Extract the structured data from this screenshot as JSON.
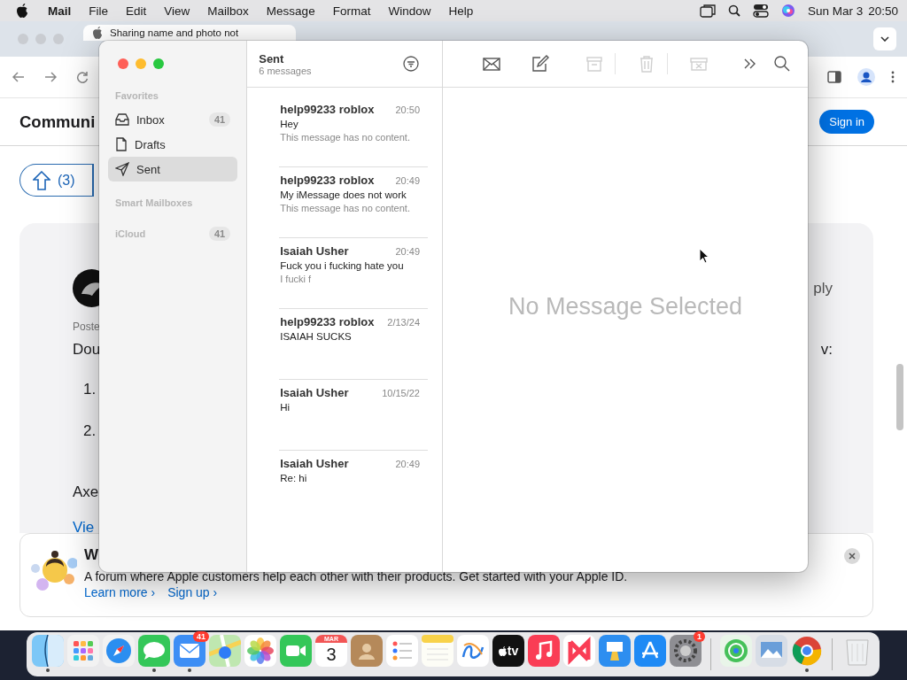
{
  "menu_bar": {
    "app": "Mail",
    "menus": [
      "File",
      "Edit",
      "View",
      "Mailbox",
      "Message",
      "Format",
      "Window",
      "Help"
    ],
    "date": "Sun Mar 3",
    "time": "20:50"
  },
  "browser": {
    "tab": {
      "title": "Sharing name and photo not"
    },
    "page": {
      "heading": "Communi",
      "sign_in": "Sign in",
      "vote_count": "(3)",
      "post": {
        "right_top": "ply",
        "posted": "Poste",
        "line": "Dou",
        "right_line": "v:",
        "list": [
          "1.",
          "2."
        ],
        "author": "Axe",
        "link": "Vie"
      },
      "banner": {
        "title": "W",
        "text": "A forum where Apple customers help each other with their products. Get started with your Apple ID.",
        "links": [
          "Learn more ›",
          "Sign up ›"
        ]
      }
    }
  },
  "mail": {
    "sidebar": [
      {
        "kind": "header",
        "label": "Favorites"
      },
      {
        "kind": "inbox",
        "label": "Inbox",
        "count": "41",
        "selected": false
      },
      {
        "kind": "drafts",
        "label": "Drafts",
        "selected": false
      },
      {
        "kind": "sent",
        "label": "Sent",
        "selected": true
      },
      {
        "kind": "header",
        "label": "Smart Mailboxes"
      },
      {
        "kind": "header",
        "label": "iCloud",
        "count": "41"
      }
    ],
    "list": {
      "title": "Sent",
      "subtitle": "6 messages"
    },
    "messages": [
      {
        "sender": "help99233 roblox",
        "time": "20:50",
        "subject": "Hey",
        "preview": "This message has no content."
      },
      {
        "sender": "help99233 roblox",
        "time": "20:49",
        "subject": "My iMessage does not work",
        "preview": "This message has no content."
      },
      {
        "sender": "Isaiah Usher",
        "time": "20:49",
        "subject": "Fuck you i fucking hate you",
        "preview": "I fucki f"
      },
      {
        "sender": "help99233 roblox",
        "time": "2/13/24",
        "subject": "ISAIAH SUCKS"
      },
      {
        "sender": "Isaiah Usher",
        "time": "10/15/22",
        "subject": "Hi"
      },
      {
        "sender": "Isaiah Usher",
        "time": "20:49",
        "subject": "Re: hi"
      }
    ],
    "toolbar": [
      {
        "kind": "get_mail",
        "disabled": false
      },
      {
        "kind": "compose",
        "disabled": false
      },
      {
        "kind": "archive",
        "disabled": true
      },
      {
        "kind": "trash",
        "disabled": true
      },
      {
        "kind": "junk",
        "disabled": true
      },
      {
        "kind": "more",
        "disabled": false
      },
      {
        "kind": "search",
        "disabled": false
      }
    ],
    "empty_text": "No Message Selected"
  },
  "dock": [
    {
      "kind": "finder",
      "running": true
    },
    {
      "kind": "launchpad",
      "running": false
    },
    {
      "kind": "safari",
      "running": false
    },
    {
      "kind": "messages",
      "running": true
    },
    {
      "kind": "mail",
      "running": true,
      "badge": "41"
    },
    {
      "kind": "maps",
      "running": false
    },
    {
      "kind": "photos",
      "running": false
    },
    {
      "kind": "facetime",
      "running": false
    },
    {
      "kind": "calendar",
      "running": false,
      "month": "MAR",
      "day": "3"
    },
    {
      "kind": "contacts",
      "running": false
    },
    {
      "kind": "reminders",
      "running": false
    },
    {
      "kind": "notes",
      "running": false
    },
    {
      "kind": "freeform",
      "running": false
    },
    {
      "kind": "tv",
      "running": false,
      "label": "tv"
    },
    {
      "kind": "music",
      "running": false
    },
    {
      "kind": "news",
      "running": false
    },
    {
      "kind": "keynote",
      "running": false
    },
    {
      "kind": "appstore",
      "running": false
    },
    {
      "kind": "settings",
      "running": false,
      "badge": "1"
    },
    {
      "kind": "separator"
    },
    {
      "kind": "findmy",
      "running": false
    },
    {
      "kind": "preview",
      "running": false
    },
    {
      "kind": "chrome",
      "running": true
    },
    {
      "kind": "separator"
    },
    {
      "kind": "trash",
      "running": false
    }
  ]
}
